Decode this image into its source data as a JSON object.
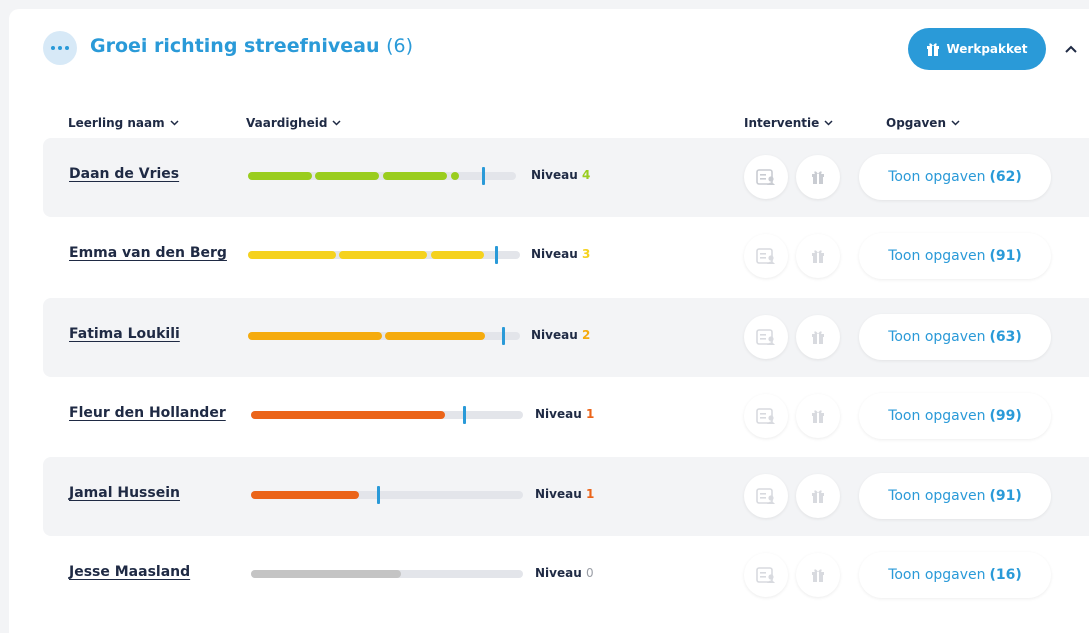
{
  "group": {
    "title": "Groei richting streefniveau",
    "count": "(6)",
    "werkpakket_label": "Werkpakket"
  },
  "columns": {
    "name": "Leerling naam",
    "skill": "Vaardigheid",
    "intervention": "Interventie",
    "exercises": "Opgaven"
  },
  "colors": {
    "accent": "#2a9ad8",
    "level4": "#9acd1e",
    "level3": "#f5d21e",
    "level2": "#f5ab0e",
    "level1": "#eb6419",
    "level0": "#c4c4c4"
  },
  "students": [
    {
      "name": "Daan de Vries",
      "niveau_label": "Niveau",
      "level": "4",
      "exercises_label": "Toon opgaven",
      "exercises_count": "(62)"
    },
    {
      "name": "Emma van den Berg",
      "niveau_label": "Niveau",
      "level": "3",
      "exercises_label": "Toon opgaven",
      "exercises_count": "(91)"
    },
    {
      "name": "Fatima Loukili",
      "niveau_label": "Niveau",
      "level": "2",
      "exercises_label": "Toon opgaven",
      "exercises_count": "(63)"
    },
    {
      "name": "Fleur den Hollander",
      "niveau_label": "Niveau",
      "level": "1",
      "exercises_label": "Toon opgaven",
      "exercises_count": "(99)"
    },
    {
      "name": "Jamal Hussein",
      "niveau_label": "Niveau",
      "level": "1",
      "exercises_label": "Toon opgaven",
      "exercises_count": "(91)"
    },
    {
      "name": "Jesse Maasland",
      "niveau_label": "Niveau",
      "level": "0",
      "exercises_label": "Toon opgaven",
      "exercises_count": "(16)"
    }
  ],
  "icons": {
    "group_menu": "dots-icon",
    "werkpakket": "gift-icon",
    "collapse": "chevron-up-icon",
    "sort": "chevron-down-icon",
    "intervention_a": "student-card-icon",
    "intervention_b": "gift-icon"
  }
}
